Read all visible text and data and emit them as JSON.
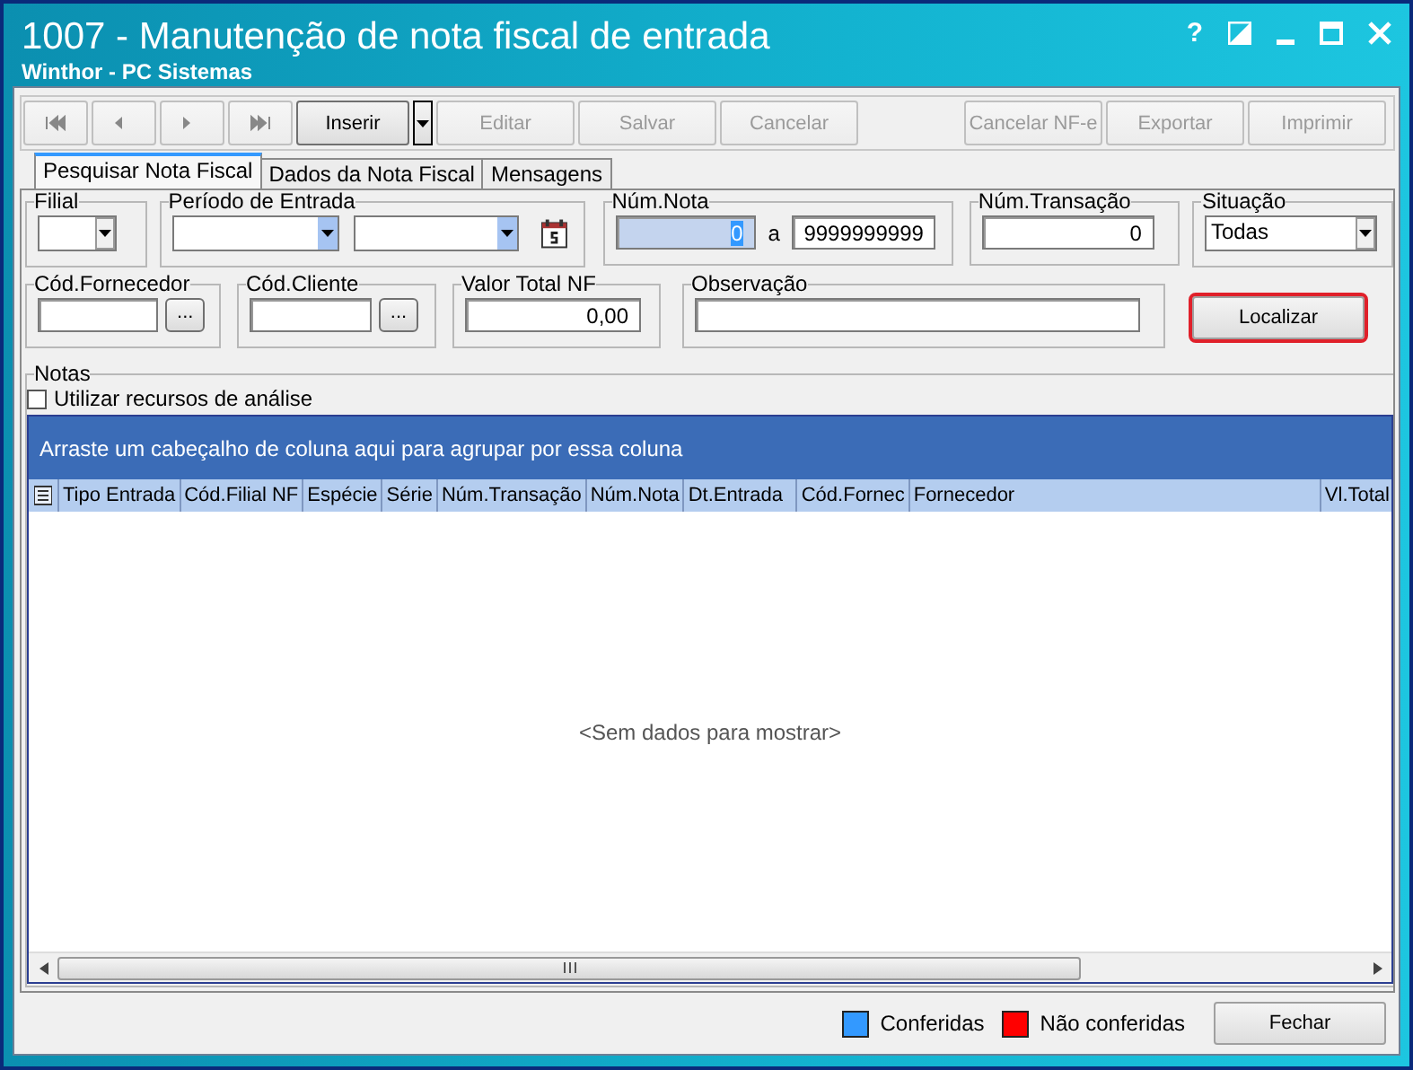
{
  "window": {
    "title": "1007 - Manutenção de nota fiscal de entrada",
    "subtitle": "Winthor - PC Sistemas",
    "help": "?"
  },
  "toolbar": {
    "nav_buttons": [
      {
        "kind": "first",
        "disabled": true
      },
      {
        "kind": "prev",
        "disabled": true
      },
      {
        "kind": "next",
        "disabled": true
      },
      {
        "kind": "last",
        "disabled": true
      }
    ],
    "buttons": [
      {
        "label": "Inserir",
        "disabled": false,
        "dropdown": true
      },
      {
        "label": "Editar",
        "disabled": true,
        "dropdown": false
      },
      {
        "label": "Salvar",
        "disabled": true,
        "dropdown": false
      },
      {
        "label": "Cancelar",
        "disabled": true,
        "dropdown": false
      },
      {
        "label": "Cancelar NF-e",
        "disabled": true,
        "dropdown": false
      },
      {
        "label": "Exportar",
        "disabled": true,
        "dropdown": false
      },
      {
        "label": "Imprimir",
        "disabled": true,
        "dropdown": false
      }
    ]
  },
  "tabs": [
    {
      "label": "Pesquisar Nota Fiscal",
      "selected": true
    },
    {
      "label": "Dados da Nota Fiscal",
      "selected": false
    },
    {
      "label": "Mensagens",
      "selected": false
    }
  ],
  "filters": {
    "filial": {
      "label": "Filial"
    },
    "periodo": {
      "label": "Período de Entrada"
    },
    "num_nota": {
      "label": "Núm.Nota",
      "from": "0",
      "separator": "a",
      "to": "9999999999",
      "focused": true
    },
    "num_transacao": {
      "label": "Núm.Transação",
      "value": "0"
    },
    "situacao": {
      "label": "Situação",
      "value": "Todas"
    },
    "cod_fornecedor": {
      "label": "Cód.Fornecedor",
      "button": "..."
    },
    "cod_cliente": {
      "label": "Cód.Cliente",
      "button": "..."
    },
    "valor_total": {
      "label": "Valor Total NF",
      "value": "0,00"
    },
    "observacao": {
      "label": "Observação"
    },
    "search_button": {
      "label": "Localizar",
      "highlighted": true
    }
  },
  "notas": {
    "label": "Notas",
    "analysis_checkbox": {
      "label": "Utilizar recursos de análise",
      "checked": false
    },
    "group_hint": "Arraste um cabeçalho de coluna aqui para agrupar por essa coluna",
    "columns": [
      "Tipo Entrada",
      "Cód.Filial NF",
      "Espécie",
      "Série",
      "Núm.Transação",
      "Núm.Nota",
      "Dt.Entrada",
      "Cód.Fornec",
      "Fornecedor",
      "Vl.Total"
    ],
    "empty_text": "<Sem dados para mostrar>"
  },
  "legend": [
    {
      "label": "Conferidas",
      "color": "#3399ff"
    },
    {
      "label": "Não conferidas",
      "color": "#ff0000"
    }
  ],
  "close_button": "Fechar"
}
